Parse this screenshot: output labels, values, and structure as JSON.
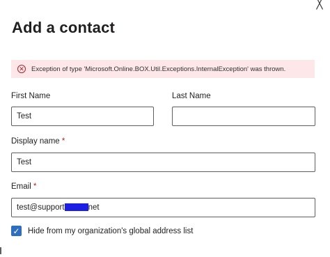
{
  "dialog": {
    "title": "Add a contact",
    "close_glyph": "╳"
  },
  "error": {
    "icon": "error-circle-icon",
    "glyph": "✕",
    "message": "Exception of type 'Microsoft.Online.BOX.Util.Exceptions.InternalException' was thrown."
  },
  "form": {
    "first_name": {
      "label": "First Name",
      "value": "Test"
    },
    "last_name": {
      "label": "Last Name",
      "value": ""
    },
    "display_name": {
      "label": "Display name",
      "required_mark": "*",
      "value": "Test"
    },
    "email": {
      "label": "Email",
      "required_mark": "*",
      "value_prefix": "test@support",
      "value_suffix": "net"
    },
    "hide_from_gal": {
      "label": "Hide from my organization's global address list",
      "checked": true,
      "check_glyph": "✓"
    }
  },
  "colors": {
    "error_background": "#fde7e9",
    "error_icon": "#a4262c",
    "checkbox": "#2f6ebf",
    "redaction": "#1d1fe5"
  }
}
